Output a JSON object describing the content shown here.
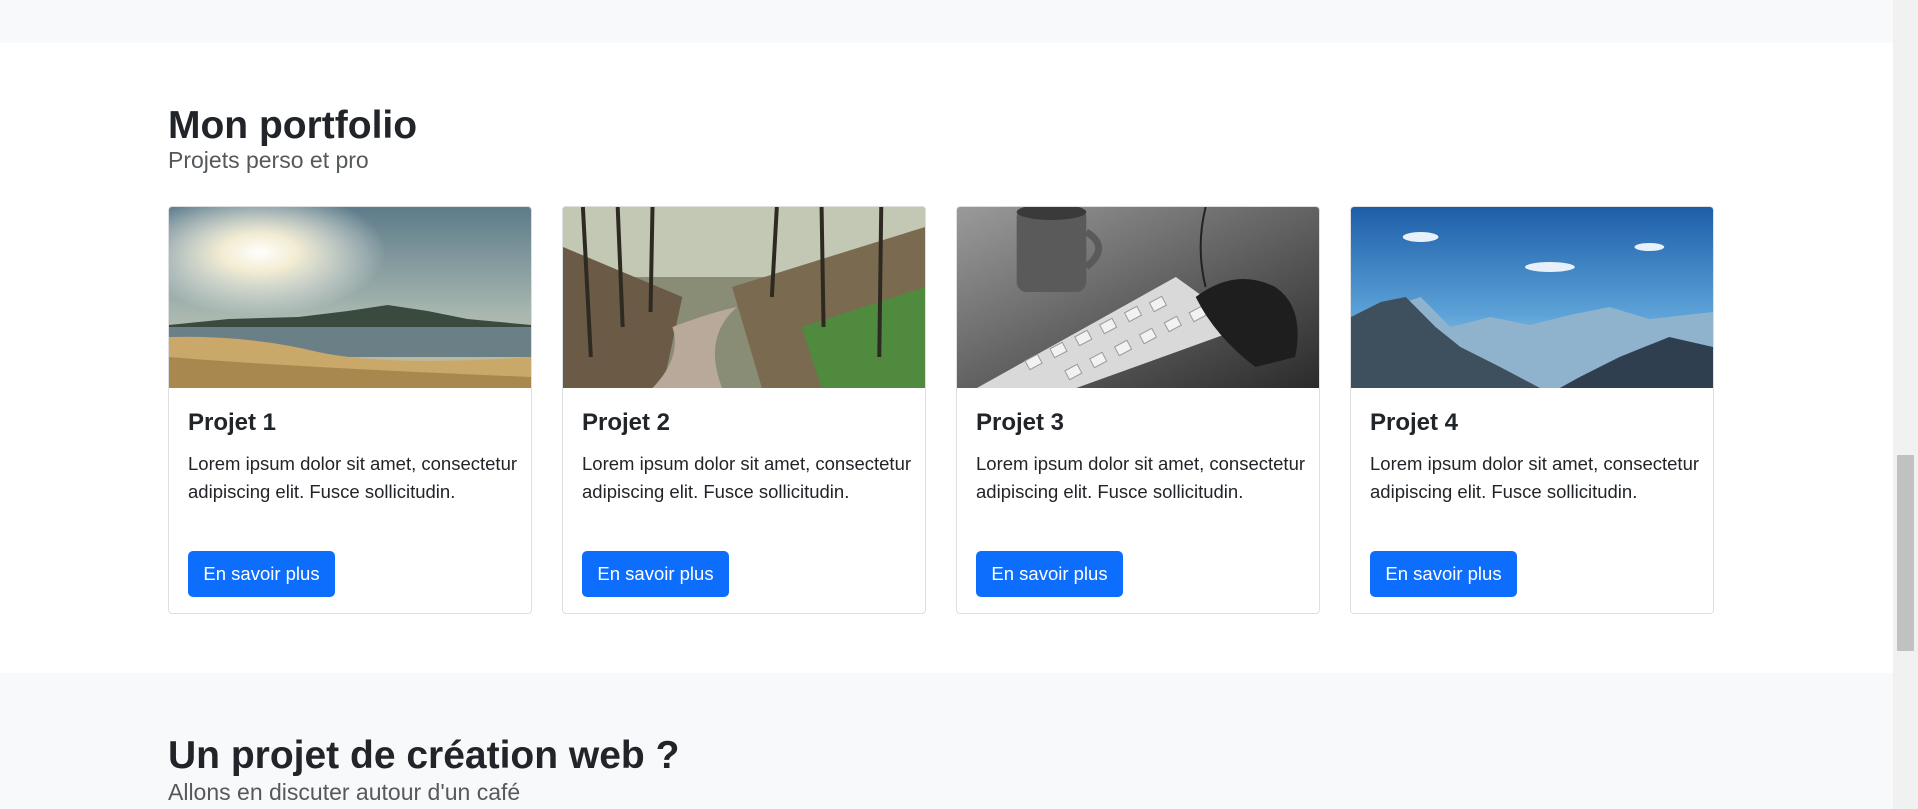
{
  "portfolio": {
    "title": "Mon portfolio",
    "subtitle": "Projets perso et pro",
    "cards": [
      {
        "title": "Projet 1",
        "text": "Lorem ipsum dolor sit amet, consectetur adipiscing elit. Fusce sollicitudin.",
        "button": "En savoir plus",
        "image": "beach-sunset-photo"
      },
      {
        "title": "Projet 2",
        "text": "Lorem ipsum dolor sit amet, consectetur adipiscing elit. Fusce sollicitudin.",
        "button": "En savoir plus",
        "image": "forest-path-photo"
      },
      {
        "title": "Projet 3",
        "text": "Lorem ipsum dolor sit amet, consectetur adipiscing elit. Fusce sollicitudin.",
        "button": "En savoir plus",
        "image": "keyboard-coffee-photo"
      },
      {
        "title": "Projet 4",
        "text": "Lorem ipsum dolor sit amet, consectetur adipiscing elit. Fusce sollicitudin.",
        "button": "En savoir plus",
        "image": "mountains-sky-photo"
      }
    ]
  },
  "contact": {
    "title": "Un projet de création web ?",
    "subtitle": "Allons en discuter autour d'un café"
  },
  "colors": {
    "primary_button": "#0d6efd",
    "section_alt_bg": "#f8f9fa",
    "text": "#212529"
  }
}
